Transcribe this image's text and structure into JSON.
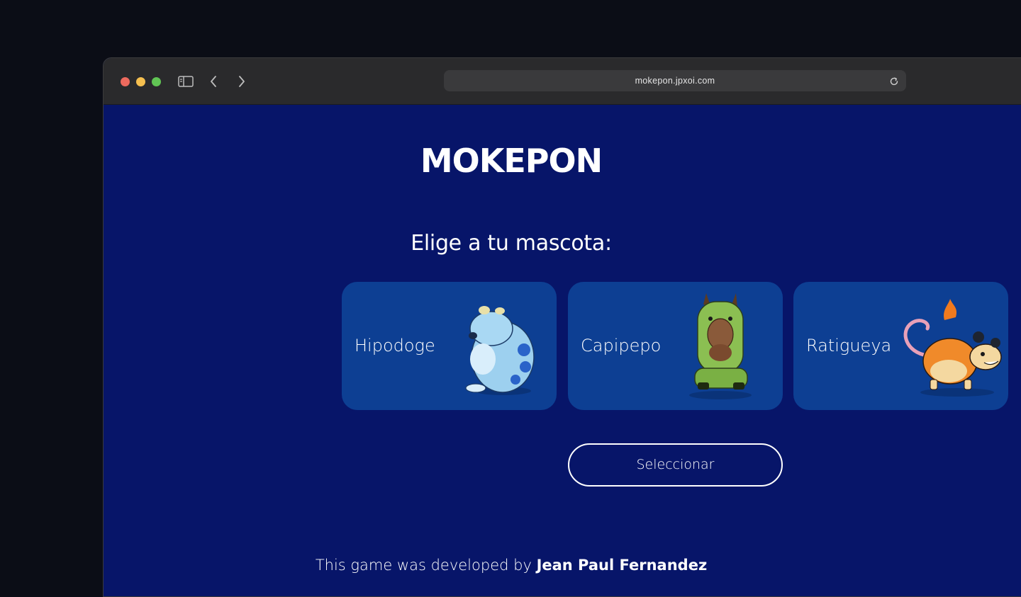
{
  "browser": {
    "url": "mokepon.jpxoi.com",
    "icons": [
      "sidebar-icon",
      "back-icon",
      "forward-icon",
      "reload-icon"
    ]
  },
  "page": {
    "logo": "MOKEPON",
    "subtitle": "Elige a tu mascota:",
    "pets": [
      {
        "name": "Hipodoge",
        "icon": "hipodoge-illustration"
      },
      {
        "name": "Capipepo",
        "icon": "capipepo-illustration"
      },
      {
        "name": "Ratigueya",
        "icon": "ratigueya-illustration"
      }
    ],
    "select_button": "Seleccionar",
    "footer": {
      "prefix": "This game was developed by ",
      "author": "Jean Paul Fernandez"
    }
  },
  "colors": {
    "page_background": "#071569",
    "card_background": "#0d3f93",
    "text": "#ffffff"
  }
}
